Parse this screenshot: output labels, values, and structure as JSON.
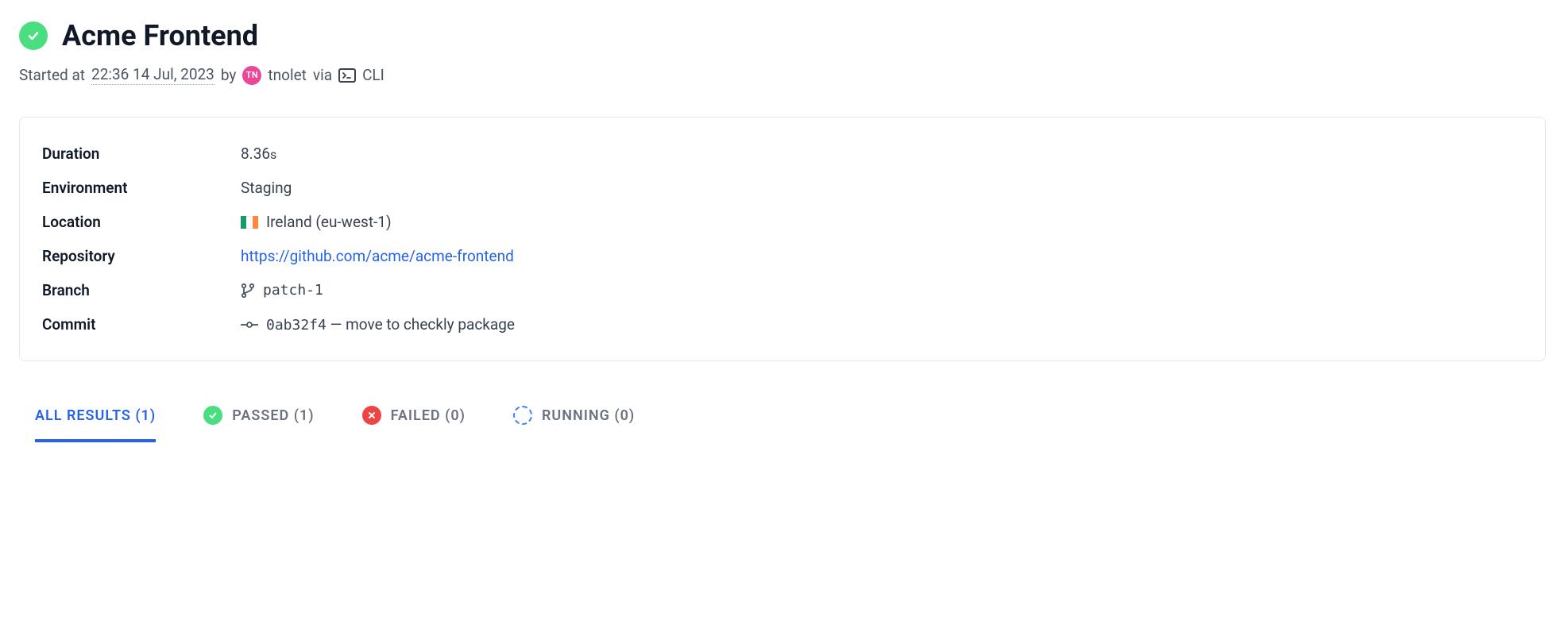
{
  "header": {
    "title": "Acme Frontend"
  },
  "subheader": {
    "started_prefix": "Started at",
    "started_time": "22:36 14 Jul, 2023",
    "by": "by",
    "avatar_initials": "TN",
    "username": "tnolet",
    "via": "via",
    "source": "CLI"
  },
  "details": {
    "duration": {
      "label": "Duration",
      "value": "8.36",
      "unit": "s"
    },
    "environment": {
      "label": "Environment",
      "value": "Staging"
    },
    "location": {
      "label": "Location",
      "value": "Ireland (eu-west-1)"
    },
    "repository": {
      "label": "Repository",
      "value": "https://github.com/acme/acme-frontend"
    },
    "branch": {
      "label": "Branch",
      "value": "patch-1"
    },
    "commit": {
      "label": "Commit",
      "hash": "0ab32f4",
      "sep": " — ",
      "message": "move to checkly package"
    }
  },
  "tabs": {
    "all": "ALL RESULTS (1)",
    "passed": "PASSED (1)",
    "failed": "FAILED (0)",
    "running": "RUNNING (0)"
  }
}
